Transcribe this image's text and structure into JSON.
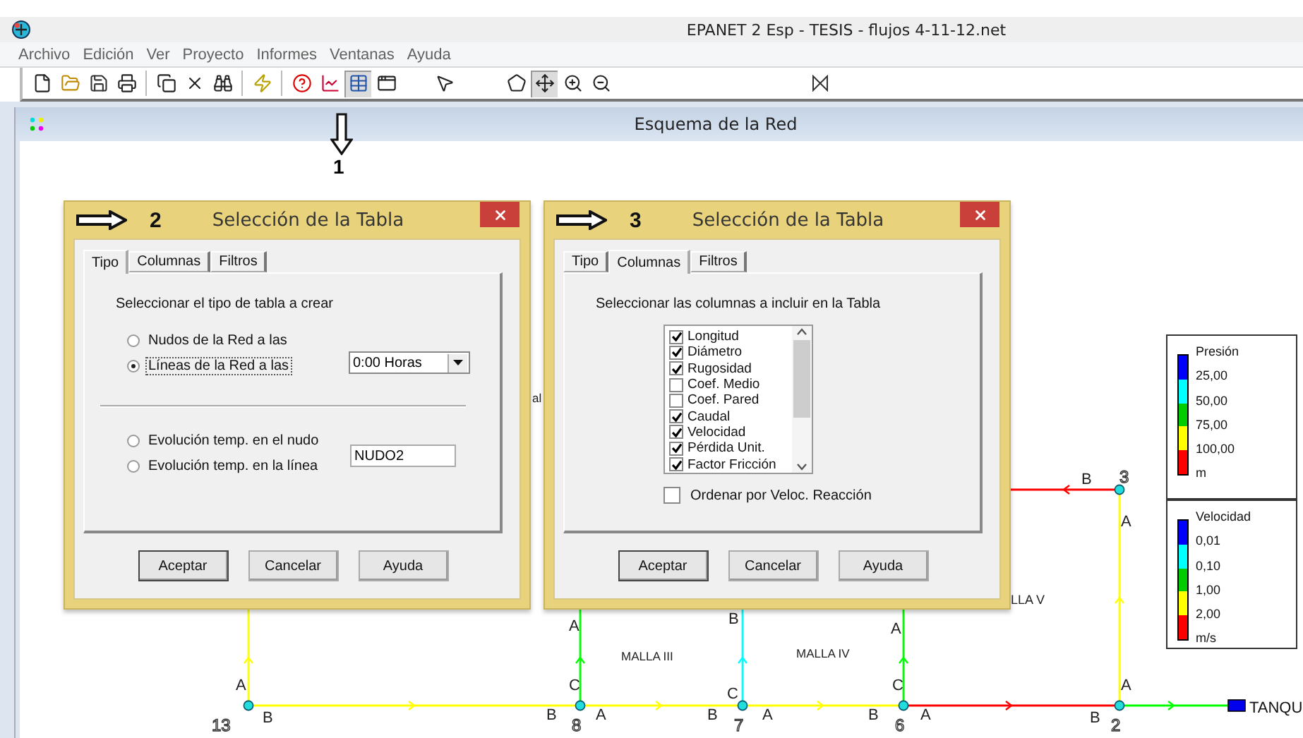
{
  "app": {
    "title": "EPANET 2 Esp - TESIS - flujos 4-11-12.net"
  },
  "menu": [
    "Archivo",
    "Edición",
    "Ver",
    "Proyecto",
    "Informes",
    "Ventanas",
    "Ayuda"
  ],
  "toolbar": [
    {
      "items": [
        {
          "kind": "new",
          "pressed": false
        },
        {
          "kind": "open",
          "pressed": false
        },
        {
          "kind": "save",
          "pressed": false
        },
        {
          "kind": "print",
          "pressed": false
        }
      ]
    },
    {
      "items": [
        {
          "kind": "copy",
          "pressed": false
        },
        {
          "kind": "delete",
          "pressed": false
        },
        {
          "kind": "find",
          "pressed": false
        }
      ]
    },
    {
      "items": [
        {
          "kind": "run",
          "pressed": false
        }
      ]
    },
    {
      "items": [
        {
          "kind": "query",
          "pressed": false
        },
        {
          "kind": "graph",
          "pressed": false
        },
        {
          "kind": "table",
          "pressed": true
        },
        {
          "kind": "options",
          "pressed": false
        }
      ]
    },
    {
      "items": [
        {
          "kind": "select",
          "pressed": false
        }
      ]
    },
    {
      "items": [
        {
          "kind": "region",
          "pressed": false
        },
        {
          "kind": "pan",
          "pressed": true
        },
        {
          "kind": "zoomin",
          "pressed": false
        },
        {
          "kind": "zoomout",
          "pressed": false
        }
      ]
    },
    {
      "items": [
        {
          "kind": "valve",
          "pressed": false
        }
      ]
    }
  ],
  "map_window": {
    "title": "Esquema de la Red"
  },
  "callout": {
    "number": "1"
  },
  "network": {
    "nodes": [
      {
        "label": "3"
      },
      {
        "label": "13"
      },
      {
        "label": "8"
      },
      {
        "label": "7"
      },
      {
        "label": "6"
      },
      {
        "label": "2"
      }
    ],
    "pipes": [
      {
        "color": "#ffff00"
      },
      {
        "color": "#ffff00"
      },
      {
        "color": "#ffff00"
      },
      {
        "color": "#ff0000"
      },
      {
        "color": "#00ff00"
      },
      {
        "color": "#ffff00"
      },
      {
        "color": "#ff0000"
      },
      {
        "color": "#ffff00"
      },
      {
        "color": "#00ff00"
      },
      {
        "color": "#00ffff"
      },
      {
        "color": "#00ff00"
      }
    ],
    "letters": [
      "B",
      "A",
      "A",
      "B",
      "A",
      "A",
      "C",
      "C",
      "C",
      "A",
      "B",
      "B",
      "A",
      "B",
      "A",
      "B",
      "A",
      "B"
    ],
    "zones": [
      "al",
      "LLA V",
      "MALLA III",
      "MALLA IV"
    ],
    "tank": {
      "label": "TANQU"
    }
  },
  "legends": [
    {
      "title": "Presión",
      "values": [
        "25,00",
        "50,00",
        "75,00",
        "100,00"
      ],
      "unit": "m",
      "bands": [
        {
          "color": "#0000ff"
        },
        {
          "color": "#00ffff"
        },
        {
          "color": "#00cc00"
        },
        {
          "color": "#ffff00"
        },
        {
          "color": "#ff0000"
        }
      ]
    },
    {
      "title": "Velocidad",
      "values": [
        "0,01",
        "0,10",
        "1,00",
        "2,00"
      ],
      "unit": "m/s",
      "bands": [
        {
          "color": "#0000ff"
        },
        {
          "color": "#00ffff"
        },
        {
          "color": "#00cc00"
        },
        {
          "color": "#ffff00"
        },
        {
          "color": "#ff0000"
        }
      ]
    }
  ],
  "dialogs": [
    {
      "marker": "2",
      "title": "Selección de la Tabla",
      "kind": "type",
      "tabs": [
        {
          "label": "Tipo",
          "selected": true
        },
        {
          "label": "Columnas",
          "selected": false
        },
        {
          "label": "Filtros",
          "selected": false
        }
      ],
      "prompt": "Seleccionar el tipo de tabla a crear",
      "options": [
        {
          "label": "Nudos de la Red a las",
          "selected": false,
          "focused": false
        },
        {
          "label": "Líneas de la Red a las",
          "selected": true,
          "focused": true
        }
      ],
      "time": "0:00 Horas",
      "series_options": [
        {
          "label": "Evolución temp. en el nudo",
          "selected": false
        },
        {
          "label": "Evolución temp. en la línea",
          "selected": false
        }
      ],
      "node": "NUDO2",
      "buttons": [
        {
          "label": "Aceptar",
          "default": true
        },
        {
          "label": "Cancelar",
          "default": false
        },
        {
          "label": "Ayuda",
          "default": false
        }
      ]
    },
    {
      "marker": "3",
      "title": "Selección de la Tabla",
      "kind": "columns",
      "tabs": [
        {
          "label": "Tipo",
          "selected": false
        },
        {
          "label": "Columnas",
          "selected": true
        },
        {
          "label": "Filtros",
          "selected": false
        }
      ],
      "prompt": "Seleccionar las columnas a incluir en la Tabla",
      "columns": [
        {
          "label": "Longitud",
          "checked": true
        },
        {
          "label": "Diámetro",
          "checked": true
        },
        {
          "label": "Rugosidad",
          "checked": true
        },
        {
          "label": "Coef. Medio",
          "checked": false
        },
        {
          "label": "Coef. Pared",
          "checked": false
        },
        {
          "label": "Caudal",
          "checked": true
        },
        {
          "label": "Velocidad",
          "checked": true
        },
        {
          "label": "Pérdida Unit.",
          "checked": true
        },
        {
          "label": "Factor Fricción",
          "checked": true
        }
      ],
      "sort": {
        "label": "Ordenar por Veloc. Reacción",
        "checked": false
      },
      "buttons": [
        {
          "label": "Aceptar",
          "default": true
        },
        {
          "label": "Cancelar",
          "default": false
        },
        {
          "label": "Ayuda",
          "default": false
        }
      ]
    }
  ]
}
